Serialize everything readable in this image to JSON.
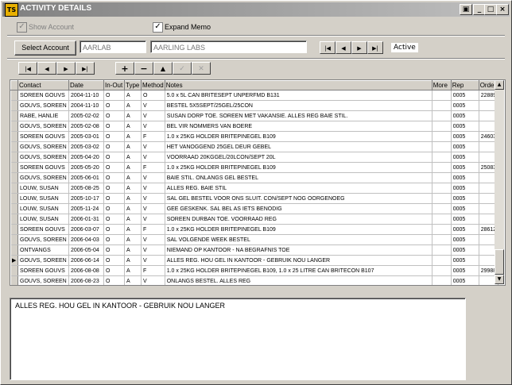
{
  "window": {
    "title": "ACTIVITY DETAILS",
    "app_icon_text": "TS"
  },
  "titlebar_buttons": [
    "▣",
    "_",
    "□",
    "×"
  ],
  "options": {
    "show_account": {
      "label": "Show Account",
      "checked": true
    },
    "expand_memo": {
      "label": "Expand Memo",
      "checked": true
    }
  },
  "account": {
    "select_label": "Select Account",
    "code": "AARLAB",
    "name": "AARLING LABS",
    "status": "Active"
  },
  "record_nav": [
    "|◀",
    "◀",
    "▶",
    "▶|"
  ],
  "toolbar": {
    "nav": [
      "|◀",
      "◀",
      "▶",
      "▶|"
    ],
    "edit": [
      "+",
      "−",
      "▲",
      "✓",
      "✕"
    ]
  },
  "grid": {
    "columns": [
      "Contact",
      "Date",
      "In-Out",
      "Type",
      "Method",
      "Notes",
      "More",
      "Rep",
      "Orde"
    ],
    "rows": [
      [
        "SOREEN GOUVS",
        "2004-11-10",
        "O",
        "A",
        "O",
        "5.0 x 5L CAN BRITESEPT UNPERFMD B131",
        "",
        "0005",
        "22889"
      ],
      [
        "GOUVS, SOREEN",
        "2004-11-10",
        "O",
        "A",
        "V",
        "BESTEL 5X5SEPT/25GEL/25CON",
        "",
        "0005",
        ""
      ],
      [
        "RABE, HANLIE",
        "2005-02-02",
        "O",
        "A",
        "V",
        "SUSAN DORP TOE. SOREEN MET VAKANSIE. ALLES REG BAIE STIL.",
        "",
        "0005",
        ""
      ],
      [
        "GOUVS, SOREEN",
        "2005-02-08",
        "O",
        "A",
        "V",
        "BEL VIR NOMMERS VAN BOERE",
        "",
        "0005",
        ""
      ],
      [
        "SOREEN GOUVS",
        "2005-03-01",
        "O",
        "A",
        "F",
        "1.0 x 25KG HOLDER BRITEPINEGEL B109",
        "",
        "0005",
        "24603"
      ],
      [
        "GOUVS, SOREEN",
        "2005-03-02",
        "O",
        "A",
        "V",
        "HET VANOGGEND 25GEL DEUR GEBEL",
        "",
        "0005",
        ""
      ],
      [
        "GOUVS, SOREEN",
        "2005-04-20",
        "O",
        "A",
        "V",
        "VOORRAAD 20KGGEL/20LCON/SEPT 20L",
        "",
        "0005",
        ""
      ],
      [
        "SOREEN GOUVS",
        "2005-05-20",
        "O",
        "A",
        "F",
        "1.0 x 25KG HOLDER BRITEPINEGEL B109",
        "",
        "0005",
        "25083"
      ],
      [
        "GOUVS, SOREEN",
        "2005-06-01",
        "O",
        "A",
        "V",
        "BAIE STIL. ONLANGS GEL BESTEL",
        "",
        "0005",
        ""
      ],
      [
        "LOUW, SUSAN",
        "2005-08-25",
        "O",
        "A",
        "V",
        "ALLES REG. BAIE STIL",
        "",
        "0005",
        ""
      ],
      [
        "LOUW, SUSAN",
        "2005-10-17",
        "O",
        "A",
        "V",
        "SAL GEL BESTEL VOOR ONS SLUIT. CON/SEPT NOG OORGENOEG",
        "",
        "0005",
        ""
      ],
      [
        "LOUW, SUSAN",
        "2005-11-24",
        "O",
        "A",
        "V",
        "GEE GESKENK. SAL BEL AS IETS BENODIG",
        "",
        "0005",
        ""
      ],
      [
        "LOUW, SUSAN",
        "2006-01-31",
        "O",
        "A",
        "V",
        "SOREEN DURBAN TOE. VOORRAAD REG",
        "",
        "0005",
        ""
      ],
      [
        "SOREEN GOUVS",
        "2006-03-07",
        "O",
        "A",
        "F",
        "1.0 x 25KG HOLDER BRITEPINEGEL B109",
        "",
        "0005",
        "28612"
      ],
      [
        "GOUVS, SOREEN",
        "2006-04-03",
        "O",
        "A",
        "V",
        "SAL VOLGENDE WEEK BESTEL",
        "",
        "0005",
        ""
      ],
      [
        "ONTVANGS",
        "2006-05-04",
        "O",
        "A",
        "V",
        "NIEMAND OP KANTOOR - NA BEGRAFNIS TOE",
        "",
        "0005",
        ""
      ],
      [
        "GOUVS, SOREEN",
        "2006-06-14",
        "O",
        "A",
        "V",
        "ALLES REG. HOU GEL IN KANTOOR - GEBRUIK NOU LANGER",
        "",
        "0005",
        ""
      ],
      [
        "SOREEN GOUVS",
        "2006-08-08",
        "O",
        "A",
        "F",
        "1.0 x 25KG HOLDER BRITEPINEGEL B109, 1.0 x 25 LITRE CAN BRITECON B107",
        "",
        "0005",
        "29988"
      ],
      [
        "GOUVS, SOREEN",
        "2006-08-23",
        "O",
        "A",
        "V",
        "ONLANGS BESTEL. ALLES REG",
        "",
        "0005",
        ""
      ]
    ],
    "current_row_marker": "▶"
  },
  "memo": {
    "text": "ALLES REG. HOU GEL IN KANTOOR - GEBRUIK NOU LANGER"
  }
}
